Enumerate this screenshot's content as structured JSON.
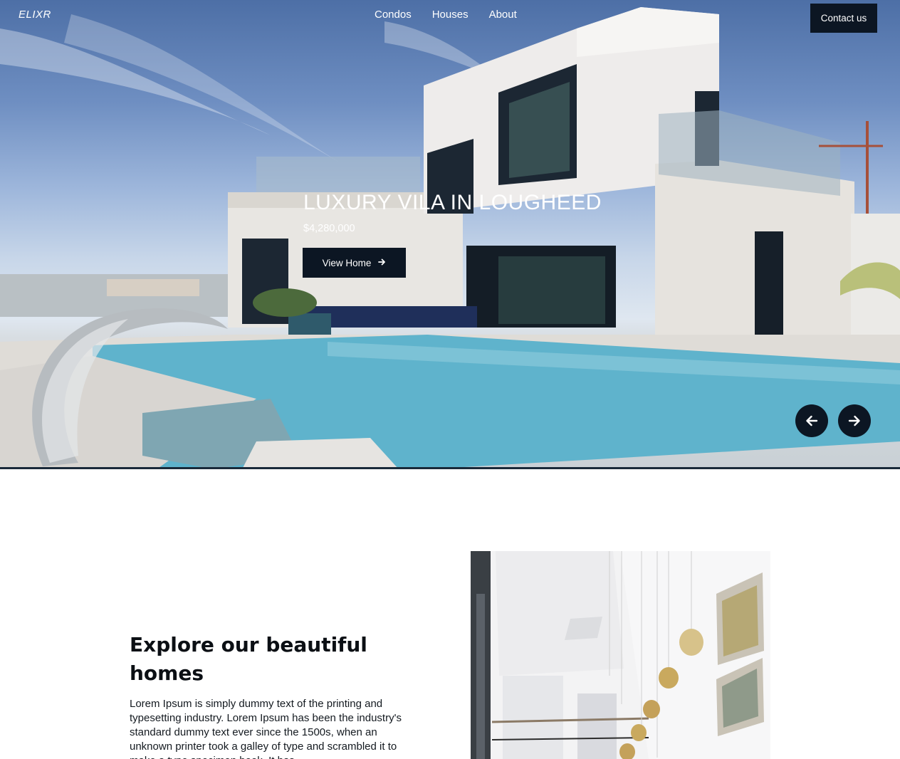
{
  "brand": {
    "logo": "ELIXR"
  },
  "nav": {
    "links": [
      "Condos",
      "Houses",
      "About"
    ],
    "contact_label": "Contact us"
  },
  "hero": {
    "title": "LUXURY VILA IN LOUGHEED",
    "price": "$4,280,000",
    "cta_label": "View Home",
    "cta_icon": "arrow-right-icon",
    "prev_icon": "arrow-left-icon",
    "next_icon": "arrow-right-icon"
  },
  "explore": {
    "title": "Explore our beautiful homes",
    "body": "Lorem Ipsum is simply dummy text of the printing and typesetting industry. Lorem Ipsum has been the industry's standard dummy text ever since the 1500s, when an unknown printer took a galley of type and scrambled it to make a type specimen book. It has"
  },
  "colors": {
    "dark": "#0c1623",
    "text": "#0b0f14",
    "white": "#ffffff",
    "pool": "#5fb3cc"
  }
}
